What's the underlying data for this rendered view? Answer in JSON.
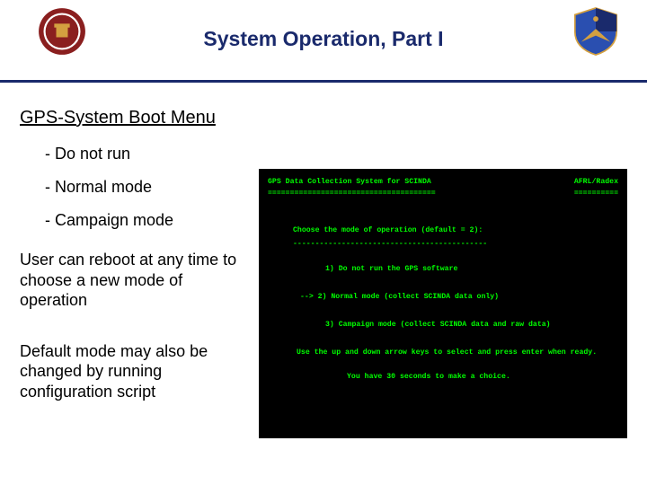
{
  "header": {
    "title": "System Operation, Part I",
    "logo_left": "university-seal",
    "logo_right": "afrl-shield"
  },
  "left": {
    "subheading": "GPS-System Boot Menu",
    "bullets": [
      "- Do not run",
      "- Normal mode",
      "- Campaign mode"
    ],
    "para1": "User can reboot at any time to choose a new mode of operation",
    "para2": "Default mode may also be changed by running configuration script"
  },
  "terminal": {
    "title_left": "GPS Data Collection System for SCINDA",
    "title_right": "AFRL/Radex",
    "rule_left": "======================================",
    "rule_right": "==========",
    "prompt": "Choose the mode of operation (default = 2):",
    "separator": "--------------------------------------------",
    "options": [
      {
        "n": "1",
        "text": "Do not run the GPS software",
        "selected": false
      },
      {
        "n": "2",
        "text": "Normal mode (collect SCINDA data only)",
        "selected": true
      },
      {
        "n": "3",
        "text": "Campaign mode (collect SCINDA data and raw data)",
        "selected": false
      }
    ],
    "instruction": "Use the up and down arrow keys to select and press enter when ready.",
    "timer": "You have 30 seconds to make a choice."
  }
}
